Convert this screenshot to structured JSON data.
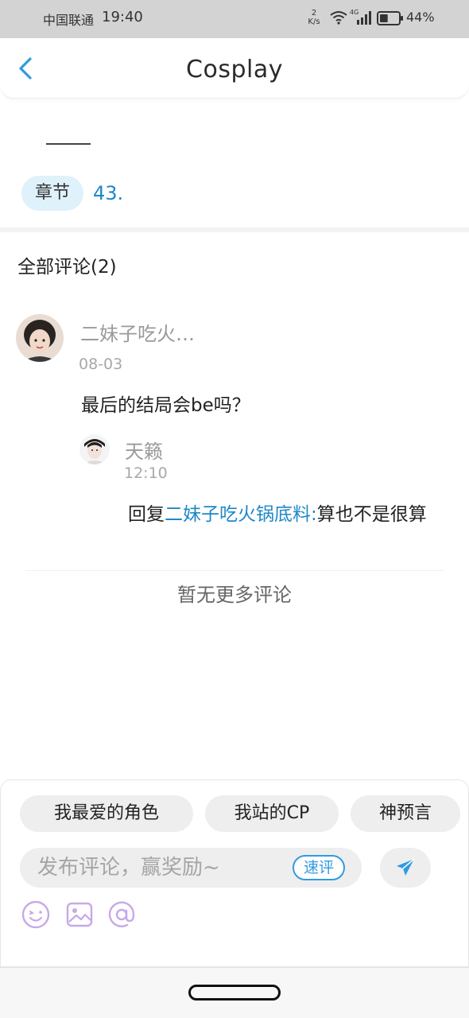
{
  "status_bar": {
    "carrier": "中国联通",
    "time": "19:40",
    "net_speed_value": "2",
    "net_speed_unit": "K/s",
    "network_type": "4G",
    "battery_pct": "44%",
    "battery_level": 0.44
  },
  "nav": {
    "title": "Cosplay"
  },
  "chapter": {
    "label": "章节",
    "number": "43."
  },
  "comments": {
    "header": "全部评论(2)",
    "items": [
      {
        "author": "二妹子吃火…",
        "date": "08-03",
        "text": "最后的结局会be吗？",
        "replies": [
          {
            "author": "天籁",
            "time": "12:10",
            "prefix": "回复",
            "mention": "二妹子吃火锅底料:",
            "text": "算也不是很算"
          }
        ]
      }
    ],
    "no_more": "暂无更多评论"
  },
  "composer": {
    "quick_tags": [
      "我最爱的角色",
      "我站的CP",
      "神预言"
    ],
    "input_placeholder": "发布评论，赢奖励~",
    "quick_review_label": "速评",
    "tools": [
      "emoji-icon",
      "image-icon",
      "at-icon"
    ],
    "accent_color": "#2f9be0"
  },
  "colors": {
    "link": "#1e88c7",
    "chip_bg": "#eeeeee",
    "chapter_bg": "#dff1fb",
    "icon_purple": "#c8a8e8"
  }
}
